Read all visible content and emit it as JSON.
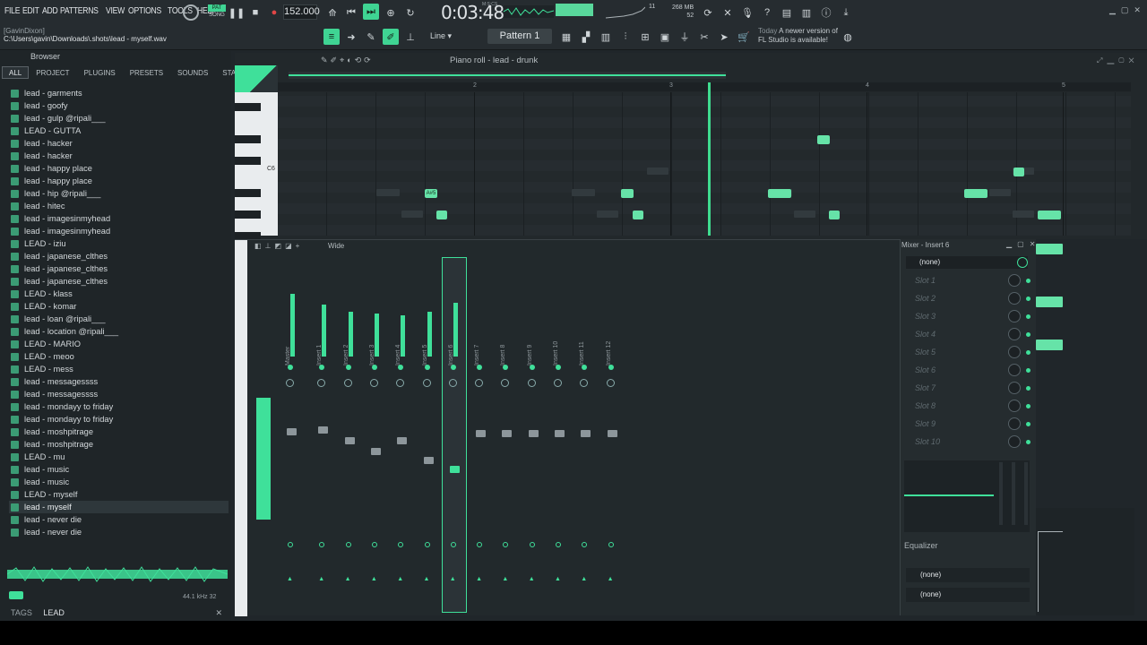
{
  "menu": [
    "FILE",
    "EDIT",
    "ADD",
    "PATTERNS",
    "VIEW",
    "OPTIONS",
    "TOOLS",
    "HELP"
  ],
  "hint": {
    "user": "[GavinDixon]",
    "path": "C:\\Users\\gavin\\Downloads\\.shots\\lead - myself.wav"
  },
  "transport": {
    "pat": "PAT",
    "song": "SONG",
    "tempo": "152.000",
    "time": "0:03:48",
    "time_sub": "M:S:CS",
    "cpu": "268 MB",
    "cpu2": "52",
    "voices": "11"
  },
  "toolbar": {
    "line_mode": "Line",
    "pattern": "Pattern 1"
  },
  "news": {
    "label": "Today",
    "text": "A newer version of",
    "text2": "FL Studio is available!"
  },
  "browser": {
    "title": "Browser",
    "tabs": [
      "ALL",
      "PROJECT",
      "PLUGINS",
      "PRESETS",
      "SOUNDS",
      "STARRED"
    ],
    "files": [
      "lead - garments",
      "lead - goofy",
      "lead - gulp @ripali___",
      "LEAD - GUTTA",
      "lead - hacker",
      "lead - hacker",
      "lead - happy place",
      "lead - happy place",
      "lead - hip @ripali___",
      "lead - hitec",
      "lead - imagesinmyhead",
      "lead - imagesinmyhead",
      "LEAD - iziu",
      "lead - japanese_clthes",
      "lead - japanese_clthes",
      "lead - japanese_clthes",
      "LEAD - klass",
      "LEAD - komar",
      "lead - loan @ripali___",
      "lead - location @ripali___",
      "LEAD - MARIO",
      "LEAD - meoo",
      "LEAD - mess",
      "lead - messagessss",
      "lead - messagessss",
      "lead - mondayy to friday",
      "lead - mondayy to friday",
      "lead - moshpitrage",
      "lead - moshpitrage",
      "LEAD - mu",
      "lead - music",
      "lead - music",
      "LEAD - myself",
      "lead - myself",
      "lead - never die",
      "lead - never die"
    ],
    "selected_index": 33,
    "sample_info": "44.1 kHz 32",
    "tags_label": "TAGS",
    "tag": "LEAD"
  },
  "pianoroll": {
    "title": "Piano roll - lead - drunk",
    "bars": [
      "2",
      "3",
      "4",
      "5"
    ],
    "key_label": "C6",
    "note_label": "A#5"
  },
  "mixer": {
    "title": "Wide",
    "strips": [
      "Master",
      "Insert 1",
      "Insert 2",
      "Insert 3",
      "Insert 4",
      "Insert 5",
      "Insert 6",
      "Insert 7",
      "Insert 8",
      "Insert 9",
      "Insert 10",
      "Insert 11",
      "Insert 12"
    ]
  },
  "insert": {
    "title": "Mixer - Insert 6",
    "preset": "(none)",
    "slots": [
      "Slot 1",
      "Slot 2",
      "Slot 3",
      "Slot 4",
      "Slot 5",
      "Slot 6",
      "Slot 7",
      "Slot 8",
      "Slot 9",
      "Slot 10"
    ],
    "eq_label": "Equalizer",
    "out1": "(none)",
    "out2": "(none)"
  }
}
